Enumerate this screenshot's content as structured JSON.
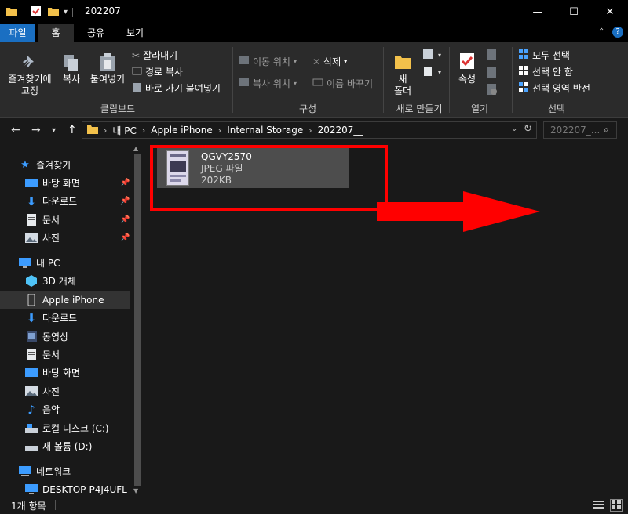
{
  "window": {
    "title": "202207__",
    "controls": [
      "minimize",
      "maximize",
      "close"
    ]
  },
  "tabs": [
    "파일",
    "홈",
    "공유",
    "보기"
  ],
  "ribbon": {
    "clipboard": {
      "pin_label_1": "즐겨찾기에",
      "pin_label_2": "고정",
      "copy": "복사",
      "paste": "붙여넣기",
      "cut": "잘라내기",
      "copy_path": "경로 복사",
      "paste_shortcut": "바로 가기 붙여넣기",
      "group": "클립보드"
    },
    "organize": {
      "move_to": "이동 위치",
      "copy_to": "복사 위치",
      "delete": "삭제",
      "rename": "이름 바꾸기",
      "group": "구성"
    },
    "new": {
      "new_folder_1": "새",
      "new_folder_2": "폴더",
      "group": "새로 만들기"
    },
    "open": {
      "properties": "속성",
      "group": "열기"
    },
    "select": {
      "select_all": "모두 선택",
      "select_none": "선택 안 함",
      "invert": "선택 영역 반전",
      "group": "선택"
    }
  },
  "address": {
    "segments": [
      "내 PC",
      "Apple iPhone",
      "Internal Storage",
      "202207__"
    ],
    "search_placeholder": "202207_..."
  },
  "sidebar": {
    "quick_access": "즐겨찾기",
    "quick_items": [
      "바탕 화면",
      "다운로드",
      "문서",
      "사진"
    ],
    "this_pc": "내 PC",
    "pc_items": [
      "3D 개체",
      "Apple iPhone",
      "다운로드",
      "동영상",
      "문서",
      "바탕 화면",
      "사진",
      "음악",
      "로컬 디스크 (C:)",
      "새 볼륨 (D:)"
    ],
    "network": "네트워크",
    "network_items": [
      "DESKTOP-P4J4UFL"
    ]
  },
  "file": {
    "name": "QGVY2570",
    "type": "JPEG 파일",
    "size": "202KB"
  },
  "status": {
    "count": "1개 항목"
  },
  "colors": {
    "accent": "#1a6fc2",
    "annotation_red": "#ff0000",
    "selected_item": "#4d4d4d"
  }
}
